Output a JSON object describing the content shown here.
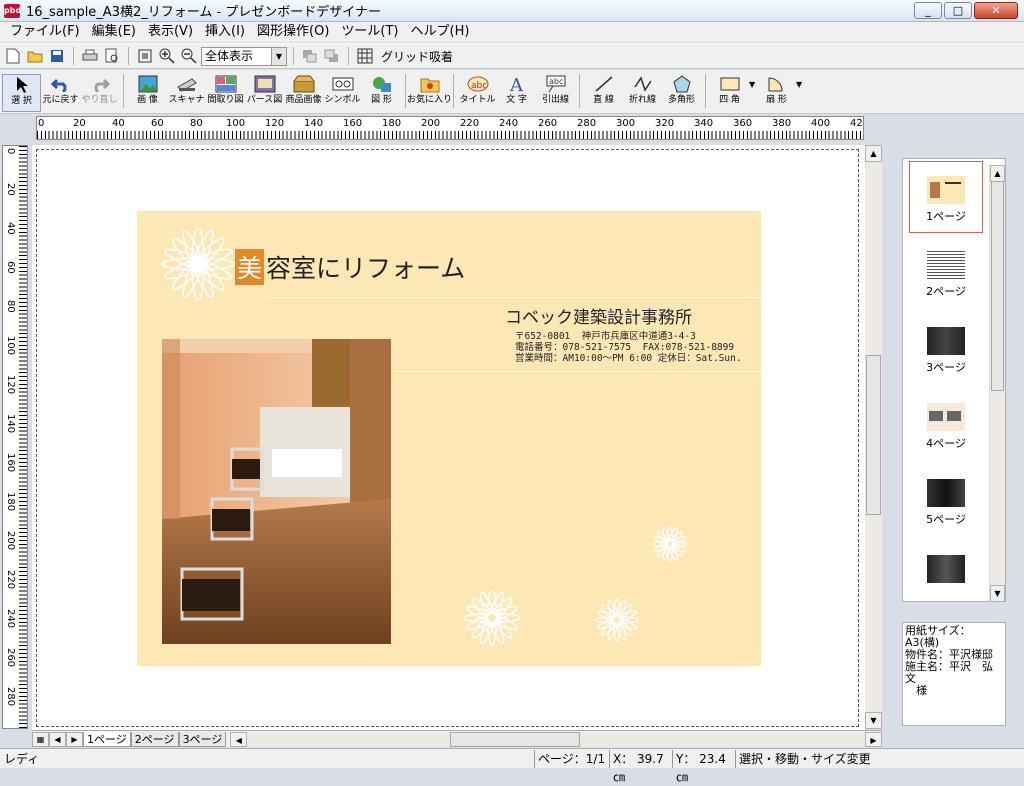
{
  "window": {
    "title": "16_sample_A3横2_リフォーム - プレゼンボードデザイナー",
    "app_icon": "pbd",
    "btn_min": "_",
    "btn_max": "□",
    "btn_close": "✕"
  },
  "menu": [
    "ファイル(F)",
    "編集(E)",
    "表示(V)",
    "挿入(I)",
    "図形操作(O)",
    "ツール(T)",
    "ヘルプ(H)"
  ],
  "toolbar1": {
    "zoom": "全体表示",
    "grid": "グリッド吸着"
  },
  "tools": [
    {
      "label": "選 択",
      "name": "select"
    },
    {
      "label": "元に戻す",
      "name": "undo"
    },
    {
      "label": "やり直し",
      "name": "redo"
    },
    {
      "label": "画 像",
      "name": "image"
    },
    {
      "label": "スキャナ",
      "name": "scanner"
    },
    {
      "label": "間取り図",
      "name": "floorplan"
    },
    {
      "label": "パース図",
      "name": "perspective"
    },
    {
      "label": "商品画像",
      "name": "product-image"
    },
    {
      "label": "シンボル",
      "name": "symbol"
    },
    {
      "label": "図 形",
      "name": "shape"
    },
    {
      "label": "お気に入り",
      "name": "favorites"
    },
    {
      "label": "タイトル",
      "name": "title"
    },
    {
      "label": "文 字",
      "name": "text"
    },
    {
      "label": "引出線",
      "name": "leader-line"
    },
    {
      "label": "直 線",
      "name": "line"
    },
    {
      "label": "折れ線",
      "name": "polyline"
    },
    {
      "label": "多角形",
      "name": "polygon"
    },
    {
      "label": "四 角",
      "name": "rectangle"
    },
    {
      "label": "扇 形",
      "name": "sector"
    }
  ],
  "ruler_h": [
    "0",
    "20",
    "40",
    "60",
    "80",
    "100",
    "120",
    "140",
    "160",
    "180",
    "200",
    "220",
    "240",
    "260",
    "280",
    "300",
    "320",
    "340",
    "360",
    "380",
    "400",
    "42"
  ],
  "ruler_v": [
    "0",
    "20",
    "40",
    "60",
    "80",
    "100",
    "120",
    "140",
    "160",
    "180",
    "200",
    "220",
    "240",
    "260",
    "280"
  ],
  "sheet": {
    "title_first": "美",
    "title_rest": "容室にリフォーム",
    "company": "コベック建築設計事務所",
    "info_lines": [
      "〒652-0801  神戸市兵庫区中道通3-4-3",
      "電話番号：078-521-7575  FAX:078-521-8899",
      "営業時間：AM10:00～PM 6:00 定休日：Sat.Sun."
    ]
  },
  "pages": {
    "tabs": [
      "1ページ",
      "2ページ",
      "3ページ"
    ],
    "thumbs": [
      "1ページ",
      "2ページ",
      "3ページ",
      "4ページ",
      "5ページ"
    ]
  },
  "props": [
    "用紙サイズ：A3(横)",
    "物件名：平沢様邸",
    "施主名：平沢　弘文",
    "　様"
  ],
  "status": {
    "ready": "レディ",
    "page": "ページ：1/1",
    "x": "X：  39.7㎝",
    "y": "Y：  23.4㎝",
    "mode": "選択・移動・サイズ変更"
  },
  "colors": {
    "sheet_bg": "#fde8b5",
    "accent": "#e08a2c"
  }
}
